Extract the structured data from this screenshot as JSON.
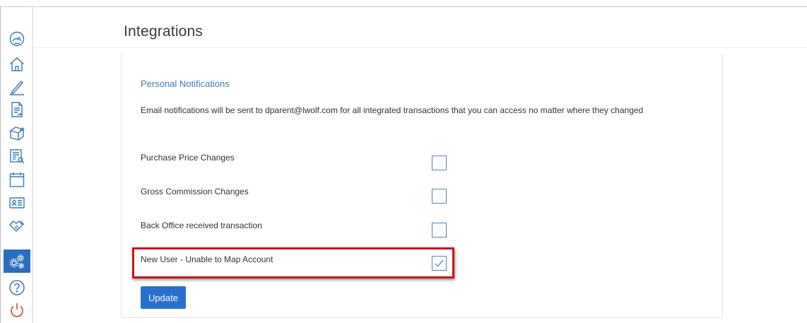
{
  "page": {
    "title": "Integrations"
  },
  "sidebar": {
    "items": [
      {
        "icon": "dashboard-gauge-icon",
        "active": false
      },
      {
        "icon": "home-icon",
        "active": false
      },
      {
        "icon": "pencil-icon",
        "active": false
      },
      {
        "icon": "document-icon",
        "active": false
      },
      {
        "icon": "box-icon",
        "active": false
      },
      {
        "icon": "report-search-icon",
        "active": false
      },
      {
        "icon": "calendar-icon",
        "active": false
      },
      {
        "icon": "contact-card-icon",
        "active": false
      },
      {
        "icon": "handshake-icon",
        "active": false
      },
      {
        "icon": "gears-icon",
        "active": true
      },
      {
        "icon": "help-icon",
        "active": false
      },
      {
        "icon": "power-icon",
        "active": false
      }
    ]
  },
  "notifications": {
    "section_title": "Personal Notifications",
    "description": "Email notifications will be sent to dparent@lwolf.com for all integrated transactions that you can access no matter where they changed",
    "rows": [
      {
        "label": "Purchase Price Changes",
        "checked": false
      },
      {
        "label": "Gross Commission Changes",
        "checked": false
      },
      {
        "label": "Back Office received transaction",
        "checked": false
      },
      {
        "label": "New User - Unable to Map Account",
        "checked": true,
        "highlighted": true
      }
    ],
    "update_label": "Update"
  },
  "colors": {
    "accent": "#2a6fd0",
    "section_title": "#3d7cc4",
    "highlight_border": "#c8161d",
    "active_nav": "#2a6fbf",
    "power_icon": "#d9352b"
  }
}
